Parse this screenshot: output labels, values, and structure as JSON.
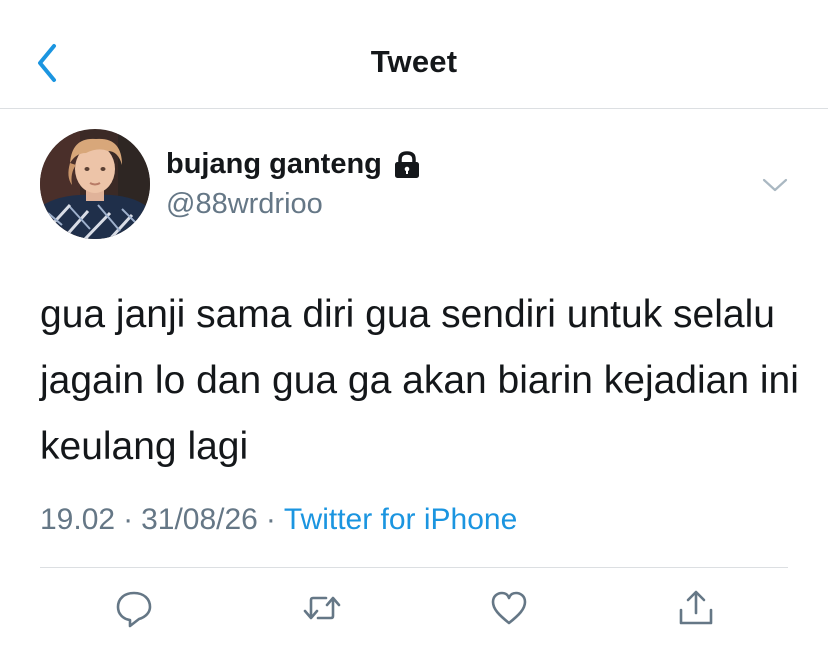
{
  "header": {
    "title": "Tweet"
  },
  "tweet": {
    "display_name": "bujang ganteng",
    "handle": "@88wrdrioo",
    "text": "gua janji sama diri gua sendiri untuk selalu jagain lo dan gua ga akan biarin kejadian ini keulang lagi",
    "time": "19.02",
    "date": "31/08/26",
    "separator": "·",
    "source": "Twitter for iPhone"
  },
  "icons": {
    "back": "chevron-left-icon",
    "protected": "lock-icon",
    "more": "chevron-down-icon",
    "reply": "comment-icon",
    "retweet": "retweet-icon",
    "like": "heart-icon",
    "share": "share-icon"
  },
  "colors": {
    "accent": "#1b95e0",
    "secondary_text": "#657786",
    "divider": "#dcdfe2"
  }
}
